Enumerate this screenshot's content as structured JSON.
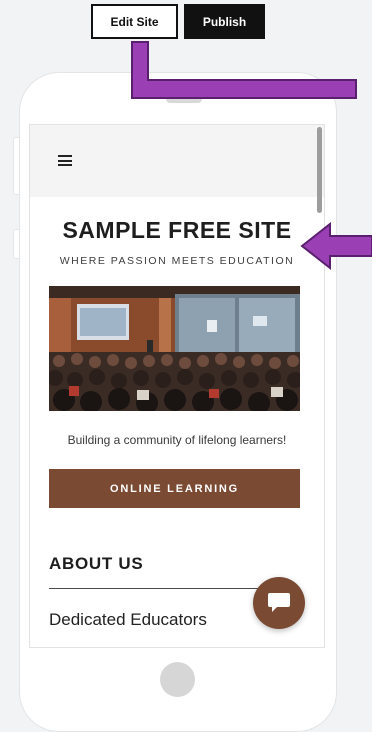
{
  "toolbar": {
    "edit_label": "Edit Site",
    "publish_label": "Publish"
  },
  "site": {
    "title": "SAMPLE FREE SITE",
    "tagline": "WHERE PASSION MEETS EDUCATION",
    "caption": "Building a community of lifelong learners!",
    "cta_label": "ONLINE LEARNING",
    "about_heading": "ABOUT US",
    "about_item": "Dedicated Educators"
  },
  "icons": {
    "menu": "hamburger-menu-icon",
    "chat": "chat-bubble-icon",
    "arrow": "annotation-arrow"
  },
  "colors": {
    "accent": "#7a4a33",
    "arrow": "#9b3fb4",
    "arrow_stroke": "#5a1f6e"
  }
}
